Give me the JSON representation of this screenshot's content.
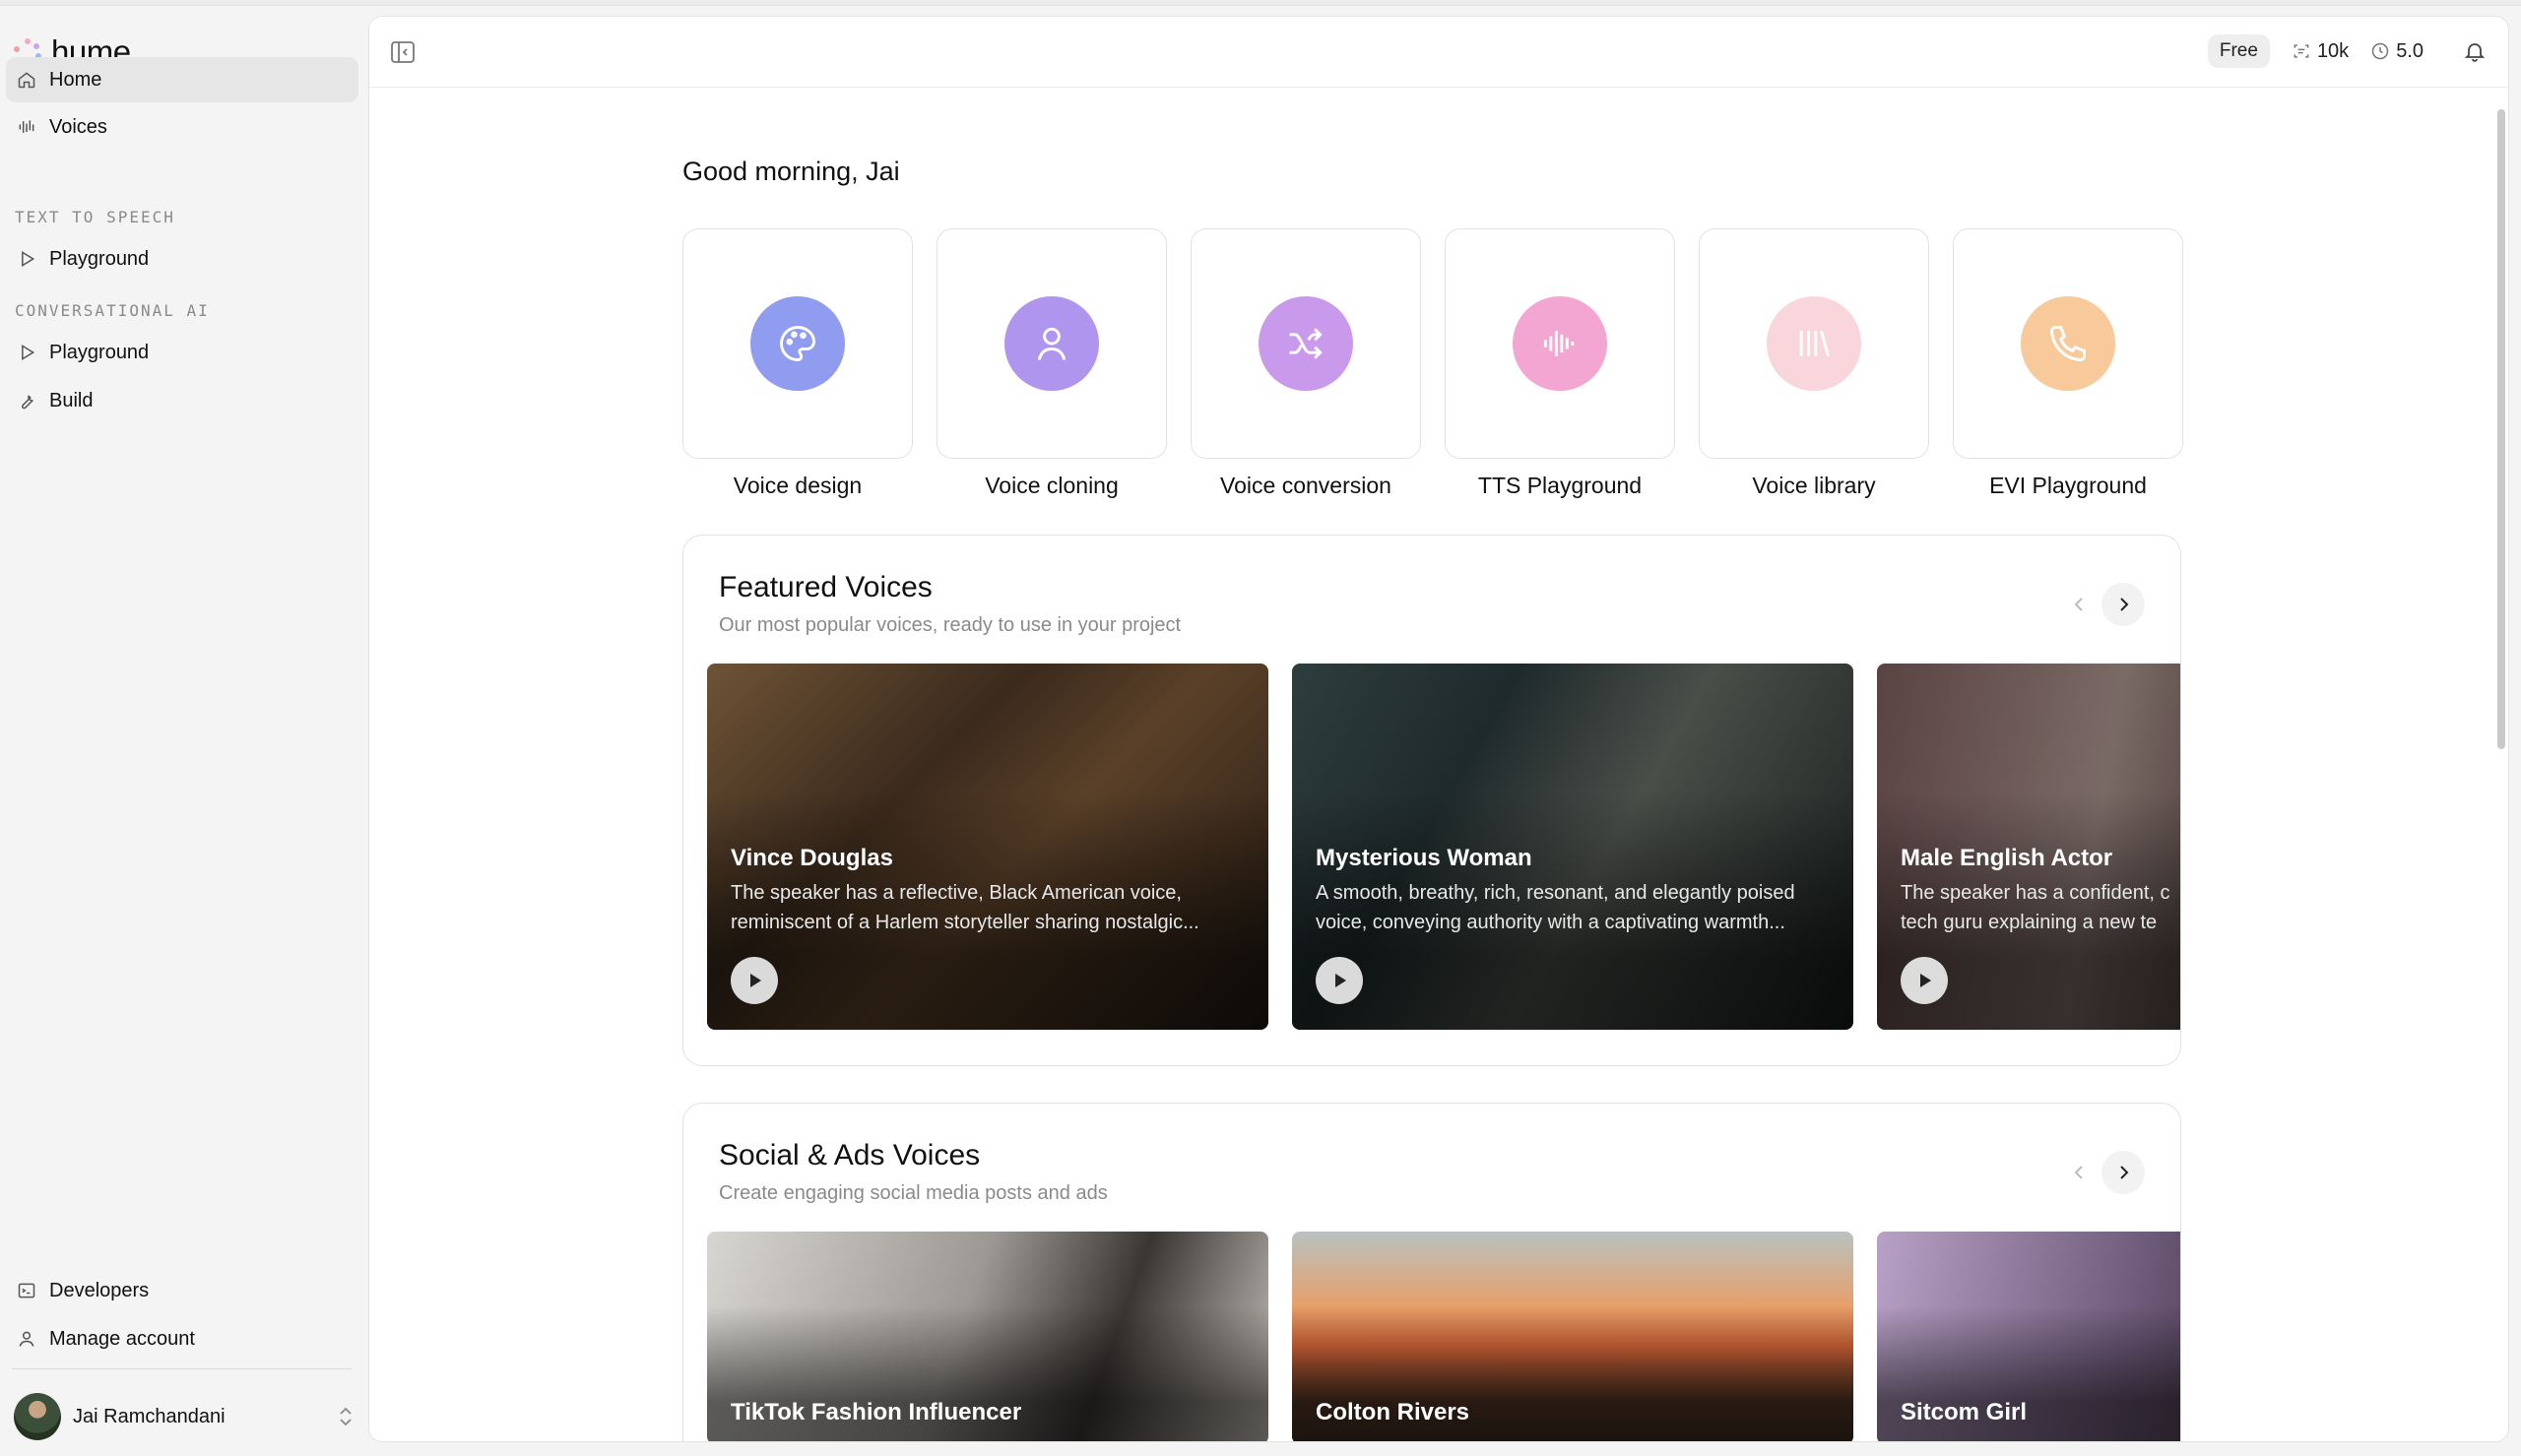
{
  "app": {
    "logo_text": "hume"
  },
  "sidebar": {
    "items_top": [
      {
        "label": "Home",
        "icon": "home-icon",
        "active": true
      },
      {
        "label": "Voices",
        "icon": "voices-icon",
        "active": false
      }
    ],
    "sections": [
      {
        "label": "TEXT TO SPEECH",
        "items": [
          {
            "label": "Playground",
            "icon": "play-outline-icon"
          }
        ]
      },
      {
        "label": "CONVERSATIONAL AI",
        "items": [
          {
            "label": "Playground",
            "icon": "play-outline-icon"
          },
          {
            "label": "Build",
            "icon": "wrench-icon"
          }
        ]
      }
    ],
    "bottom_items": [
      {
        "label": "Developers",
        "icon": "terminal-icon"
      },
      {
        "label": "Manage account",
        "icon": "user-icon"
      }
    ],
    "user": {
      "name": "Jai Ramchandani"
    }
  },
  "topbar": {
    "plan": "Free",
    "characters": "10k",
    "minutes": "5.0"
  },
  "main": {
    "greeting": "Good morning, Jai",
    "tiles": [
      {
        "label": "Voice design",
        "icon": "palette-icon",
        "color": "#8f9cf0"
      },
      {
        "label": "Voice cloning",
        "icon": "user-icon",
        "color": "#b095ee"
      },
      {
        "label": "Voice conversion",
        "icon": "shuffle-icon",
        "color": "#c99aec"
      },
      {
        "label": "TTS Playground",
        "icon": "waveform-icon",
        "color": "#f3a6d2"
      },
      {
        "label": "Voice library",
        "icon": "library-icon",
        "color": "#f9d6dc"
      },
      {
        "label": "EVI Playground",
        "icon": "phone-icon",
        "color": "#f8c99b"
      }
    ],
    "featured": {
      "title": "Featured Voices",
      "subtitle": "Our most popular voices, ready to use in your project",
      "cards": [
        {
          "name": "Vince Douglas",
          "line1": "The speaker has a reflective, Black American voice,",
          "line2": "reminiscent of a Harlem storyteller sharing nostalgic..."
        },
        {
          "name": "Mysterious Woman",
          "line1": "A smooth, breathy, rich, resonant, and elegantly poised",
          "line2": "voice, conveying authority with a captivating warmth..."
        },
        {
          "name": "Male English Actor",
          "line1": "The speaker has a confident, c",
          "line2": "tech guru explaining a new te"
        }
      ]
    },
    "social": {
      "title": "Social & Ads Voices",
      "subtitle": "Create engaging social media posts and ads",
      "cards": [
        {
          "name": "TikTok Fashion Influencer"
        },
        {
          "name": "Colton Rivers"
        },
        {
          "name": "Sitcom Girl"
        }
      ]
    }
  }
}
